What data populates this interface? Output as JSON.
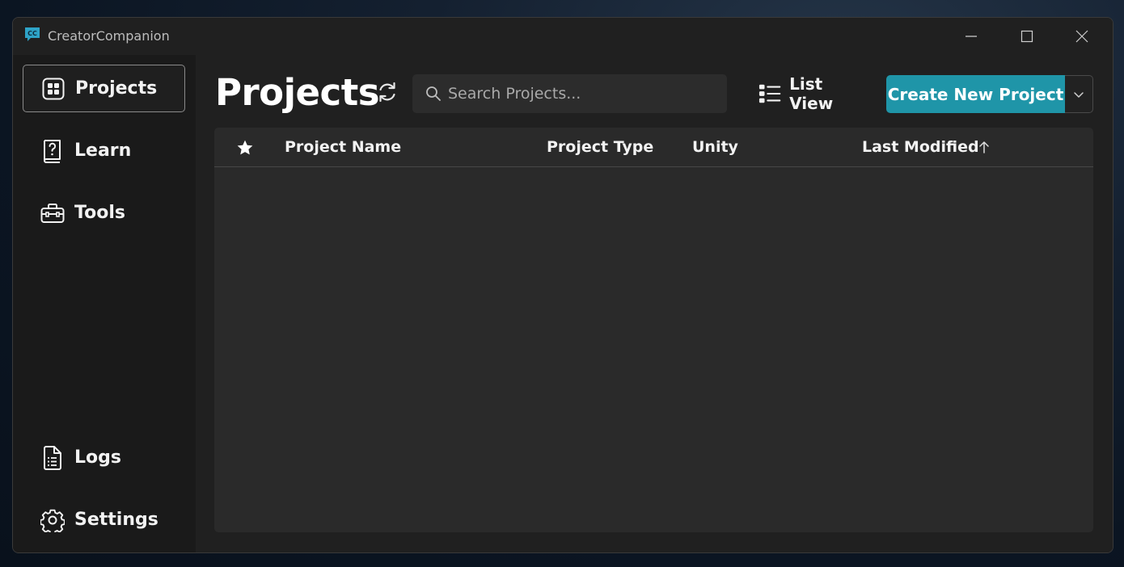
{
  "app": {
    "title": "CreatorCompanion",
    "logo_text": "CC"
  },
  "sidebar": {
    "items": [
      {
        "label": "Projects",
        "icon": "grid-icon",
        "active": true
      },
      {
        "label": "Learn",
        "icon": "question-book-icon",
        "active": false
      },
      {
        "label": "Tools",
        "icon": "toolbox-icon",
        "active": false
      },
      {
        "label": "Logs",
        "icon": "document-list-icon",
        "active": false
      },
      {
        "label": "Settings",
        "icon": "gear-icon",
        "active": false
      }
    ]
  },
  "main": {
    "title": "Projects",
    "search": {
      "placeholder": "Search Projects...",
      "value": ""
    },
    "view_toggle_label": "List View",
    "create_label": "Create New Project",
    "table": {
      "columns": [
        "Project Name",
        "Project Type",
        "Unity",
        "Last Modified"
      ],
      "sort_column": "Last Modified",
      "sort_direction": "ascending",
      "rows": []
    }
  },
  "colors": {
    "accent": "#1f95a8",
    "window_bg": "#1a1a1a",
    "content_bg": "#202020",
    "panel_bg": "#2a2a2a"
  }
}
